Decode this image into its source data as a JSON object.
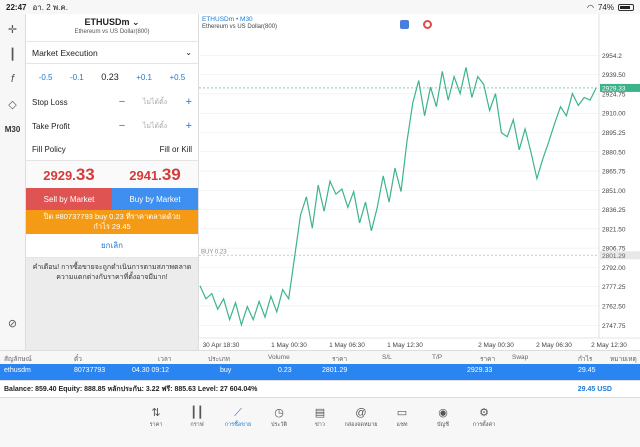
{
  "status": {
    "time": "22:47",
    "date": "อา. 2 พ.ค.",
    "battery": "74%",
    "battery_level": 0.74
  },
  "toolbar": {
    "timeframe": "M30"
  },
  "order": {
    "symbol": "ETHUSDm",
    "symbol_desc": "Ethereum vs US Dollar(800)",
    "execution": "Market Execution",
    "vol_minus_big": "-0.5",
    "vol_minus_small": "-0.1",
    "volume": "0.23",
    "vol_plus_small": "+0.1",
    "vol_plus_big": "+0.5",
    "stop_loss_label": "Stop Loss",
    "take_profit_label": "Take Profit",
    "not_set": "ไม่ได้ตั้ง",
    "fill_policy_label": "Fill Policy",
    "fill_policy_value": "Fill or Kill",
    "bid_main": "2929.",
    "bid_big": "33",
    "ask_main": "2941.",
    "ask_big": "39",
    "sell_label": "Sell by Market",
    "buy_label": "Buy by Market",
    "close_line1": "ปิด #80737793 buy 0.23 ที่ราคาตลาดด้วย",
    "close_line2": "กำไร 29.45",
    "cancel_label": "ยกเลิก",
    "warning": "คำเตือน! การซื้อขายจะถูกดำเนินการตามสภาพตลาด ความแตกต่างกับราคาที่ตั้งอาจมีมาก!"
  },
  "chart": {
    "title": "ETHUSDm • M30",
    "subtitle": "Ethereum vs US Dollar(800)",
    "buy_line_label": "BUY 0.23",
    "current_price": "2929.33",
    "buy_price_label": "2801.29",
    "colors": {
      "line": "#3cb48a",
      "grid": "#e8e8e8"
    }
  },
  "chart_data": {
    "type": "line",
    "y_ticks": [
      "2954.2",
      "2939.50",
      "2924.75",
      "2910.00",
      "2895.25",
      "2880.50",
      "2865.75",
      "2851.00",
      "2836.25",
      "2821.50",
      "2806.75",
      "2792.00",
      "2777.25",
      "2762.50",
      "2747.75"
    ],
    "x_ticks": [
      "30 Apr 18:30",
      "1 May 00:30",
      "1 May 06:30",
      "1 May 12:30",
      "2 May 00:30",
      "2 May 06:30",
      "2 May 12:30"
    ],
    "ylim": [
      2738,
      2966
    ],
    "values": [
      2778,
      2768,
      2772,
      2760,
      2768,
      2752,
      2765,
      2748,
      2762,
      2752,
      2766,
      2754,
      2770,
      2758,
      2775,
      2768,
      2800,
      2832,
      2846,
      2822,
      2855,
      2835,
      2858,
      2848,
      2852,
      2838,
      2850,
      2826,
      2842,
      2820,
      2838,
      2862,
      2842,
      2868,
      2850,
      2888,
      2918,
      2935,
      2908,
      2930,
      2915,
      2942,
      2920,
      2938,
      2925,
      2945,
      2922,
      2938,
      2932,
      2912,
      2925,
      2895,
      2892,
      2905,
      2882,
      2898,
      2880,
      2860,
      2875,
      2888,
      2902,
      2915,
      2908,
      2925,
      2916,
      2922,
      2920,
      2929
    ]
  },
  "positions": {
    "headers": [
      "สัญลักษณ์",
      "ตั๋ว",
      "เวลา",
      "ประเภท",
      "Volume",
      "ราคา",
      "S/L",
      "T/P",
      "ราคา",
      "Swap",
      "กำไร",
      "หมายเหตุ"
    ],
    "row": {
      "symbol": "ethusdm",
      "ticket": "80737793",
      "time": "04.30 09:12",
      "type": "buy",
      "volume": "0.23",
      "open_price": "2801.29",
      "price": "2929.33",
      "profit": "29.45"
    }
  },
  "balance": {
    "text": "Balance: 859.40 Equity: 888.85 หลักประกัน: 3.22 ฟรี: 885.63 Level: 27 604.04%",
    "profit": "29.45  USD"
  },
  "tabs": [
    "ราคา",
    "กราฟ",
    "การซื้อขาย",
    "ประวัติ",
    "ข่าว",
    "กล่องจดหมาย",
    "แชท",
    "บัญชี",
    "การตั้งค่า"
  ]
}
